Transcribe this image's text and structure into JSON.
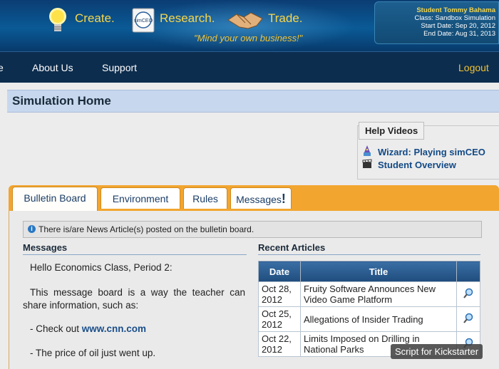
{
  "header": {
    "brand_items": [
      {
        "label": "Create.",
        "icon": "lightbulb-icon"
      },
      {
        "label": "Research.",
        "icon": "simceo-logo-icon"
      },
      {
        "label": "Trade.",
        "icon": "handshake-icon"
      }
    ],
    "research_icon_text": "simCEO",
    "tagline": "\"Mind your own business!\"",
    "info": {
      "name": "Student Tommy Bahama",
      "class": "Class: Sandbox Simulation",
      "start": "Start Date: Sep 20, 2012",
      "end": "End Date: Aug 31, 2013"
    }
  },
  "nav": {
    "items": [
      "e",
      "About Us",
      "Support"
    ],
    "logout": "Logout"
  },
  "page_title": "Simulation Home",
  "help_videos": {
    "legend": "Help Videos",
    "links": [
      {
        "label": "Wizard: Playing simCEO",
        "icon": "wizard-icon"
      },
      {
        "label": "Student Overview",
        "icon": "clapperboard-icon"
      }
    ]
  },
  "tabs": [
    {
      "label": "Bulletin Board",
      "active": true
    },
    {
      "label": "Environment",
      "active": false
    },
    {
      "label": "Rules",
      "active": false
    },
    {
      "label": "Messages",
      "active": false,
      "badge": "!"
    }
  ],
  "notice": "There is/are News Article(s) posted on the bulletin board.",
  "messages": {
    "heading": "Messages",
    "greeting": "Hello Economics Class, Period 2:",
    "para1": "This message board is a way the teacher can share information, such as:",
    "item1_prefix": "- Check out",
    "item1_link": "www.cnn.com",
    "item2": "- The price of oil just went up."
  },
  "articles": {
    "heading": "Recent Articles",
    "columns": [
      "Date",
      "Title"
    ],
    "rows": [
      {
        "date": "Oct 28, 2012",
        "title": "Fruity Software Announces New Video Game Platform"
      },
      {
        "date": "Oct 25, 2012",
        "title": "Allegations of Insider Trading"
      },
      {
        "date": "Oct 22, 2012",
        "title": "Limits Imposed on Drilling in National Parks"
      }
    ]
  },
  "overlay": "Script for Kickstarter",
  "colors": {
    "accent": "#f2a52f",
    "nav": "#0d2d4e",
    "link": "#134a86",
    "brand": "#f7d64a"
  }
}
